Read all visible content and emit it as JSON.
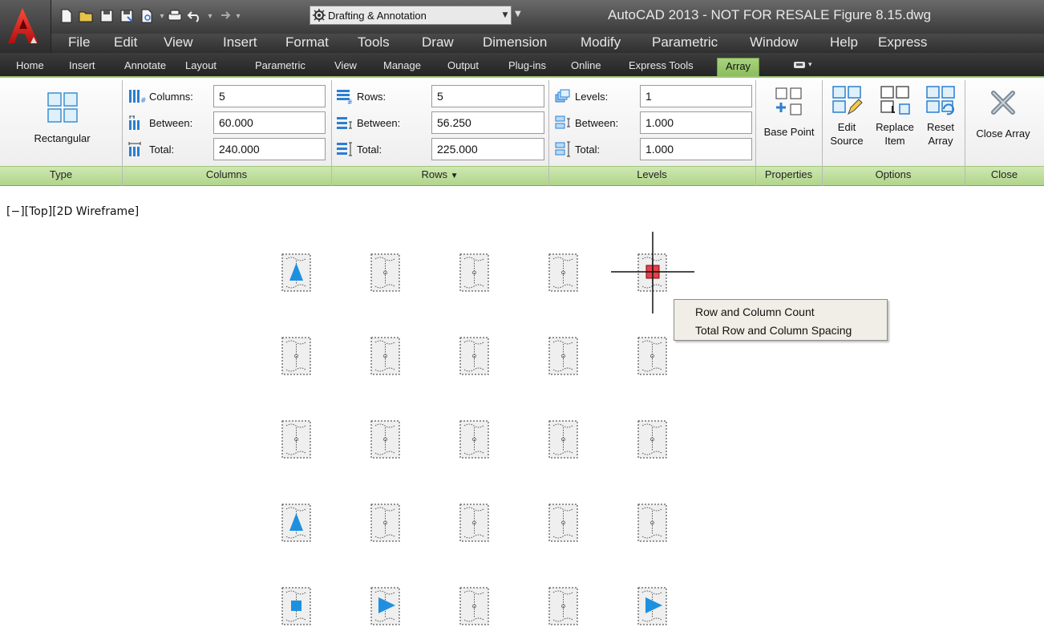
{
  "title": "AutoCAD 2013 - NOT FOR RESALE   Figure 8.15.dwg",
  "workspace": "Drafting & Annotation",
  "menu": [
    "File",
    "Edit",
    "View",
    "Insert",
    "Format",
    "Tools",
    "Draw",
    "Dimension",
    "Modify",
    "Parametric",
    "Window",
    "Help",
    "Express"
  ],
  "ribbon_tabs": [
    "Home",
    "Insert",
    "Annotate",
    "Layout",
    "Parametric",
    "View",
    "Manage",
    "Output",
    "Plug-ins",
    "Online",
    "Express Tools",
    "Array"
  ],
  "active_tab": "Array",
  "panels": {
    "type": {
      "label": "Type",
      "button": "Rectangular"
    },
    "columns": {
      "label": "Columns",
      "count_label": "Columns:",
      "count": "5",
      "between_label": "Between:",
      "between": "60.000",
      "total_label": "Total:",
      "total": "240.000"
    },
    "rows": {
      "label": "Rows",
      "count_label": "Rows:",
      "count": "5",
      "between_label": "Between:",
      "between": "56.250",
      "total_label": "Total:",
      "total": "225.000"
    },
    "levels": {
      "label": "Levels",
      "count_label": "Levels:",
      "count": "1",
      "between_label": "Between:",
      "between": "1.000",
      "total_label": "Total:",
      "total": "1.000"
    },
    "properties": {
      "label": "Properties",
      "base_point": "Base Point"
    },
    "options": {
      "label": "Options",
      "edit_source_1": "Edit",
      "edit_source_2": "Source",
      "replace_item_1": "Replace",
      "replace_item_2": "Item",
      "reset_array_1": "Reset",
      "reset_array_2": "Array"
    },
    "close": {
      "label": "Close",
      "close_array": "Close Array"
    }
  },
  "viewport_label": "[−][Top][2D Wireframe]",
  "context_menu": [
    "Row and Column Count",
    "Total Row and Column Spacing"
  ],
  "array": {
    "columns": 5,
    "rows": 5
  },
  "colors": {
    "ribbon_accent": "#9fc77b",
    "grip_blue": "#1e90e0",
    "grip_selected": "#e8404a"
  }
}
